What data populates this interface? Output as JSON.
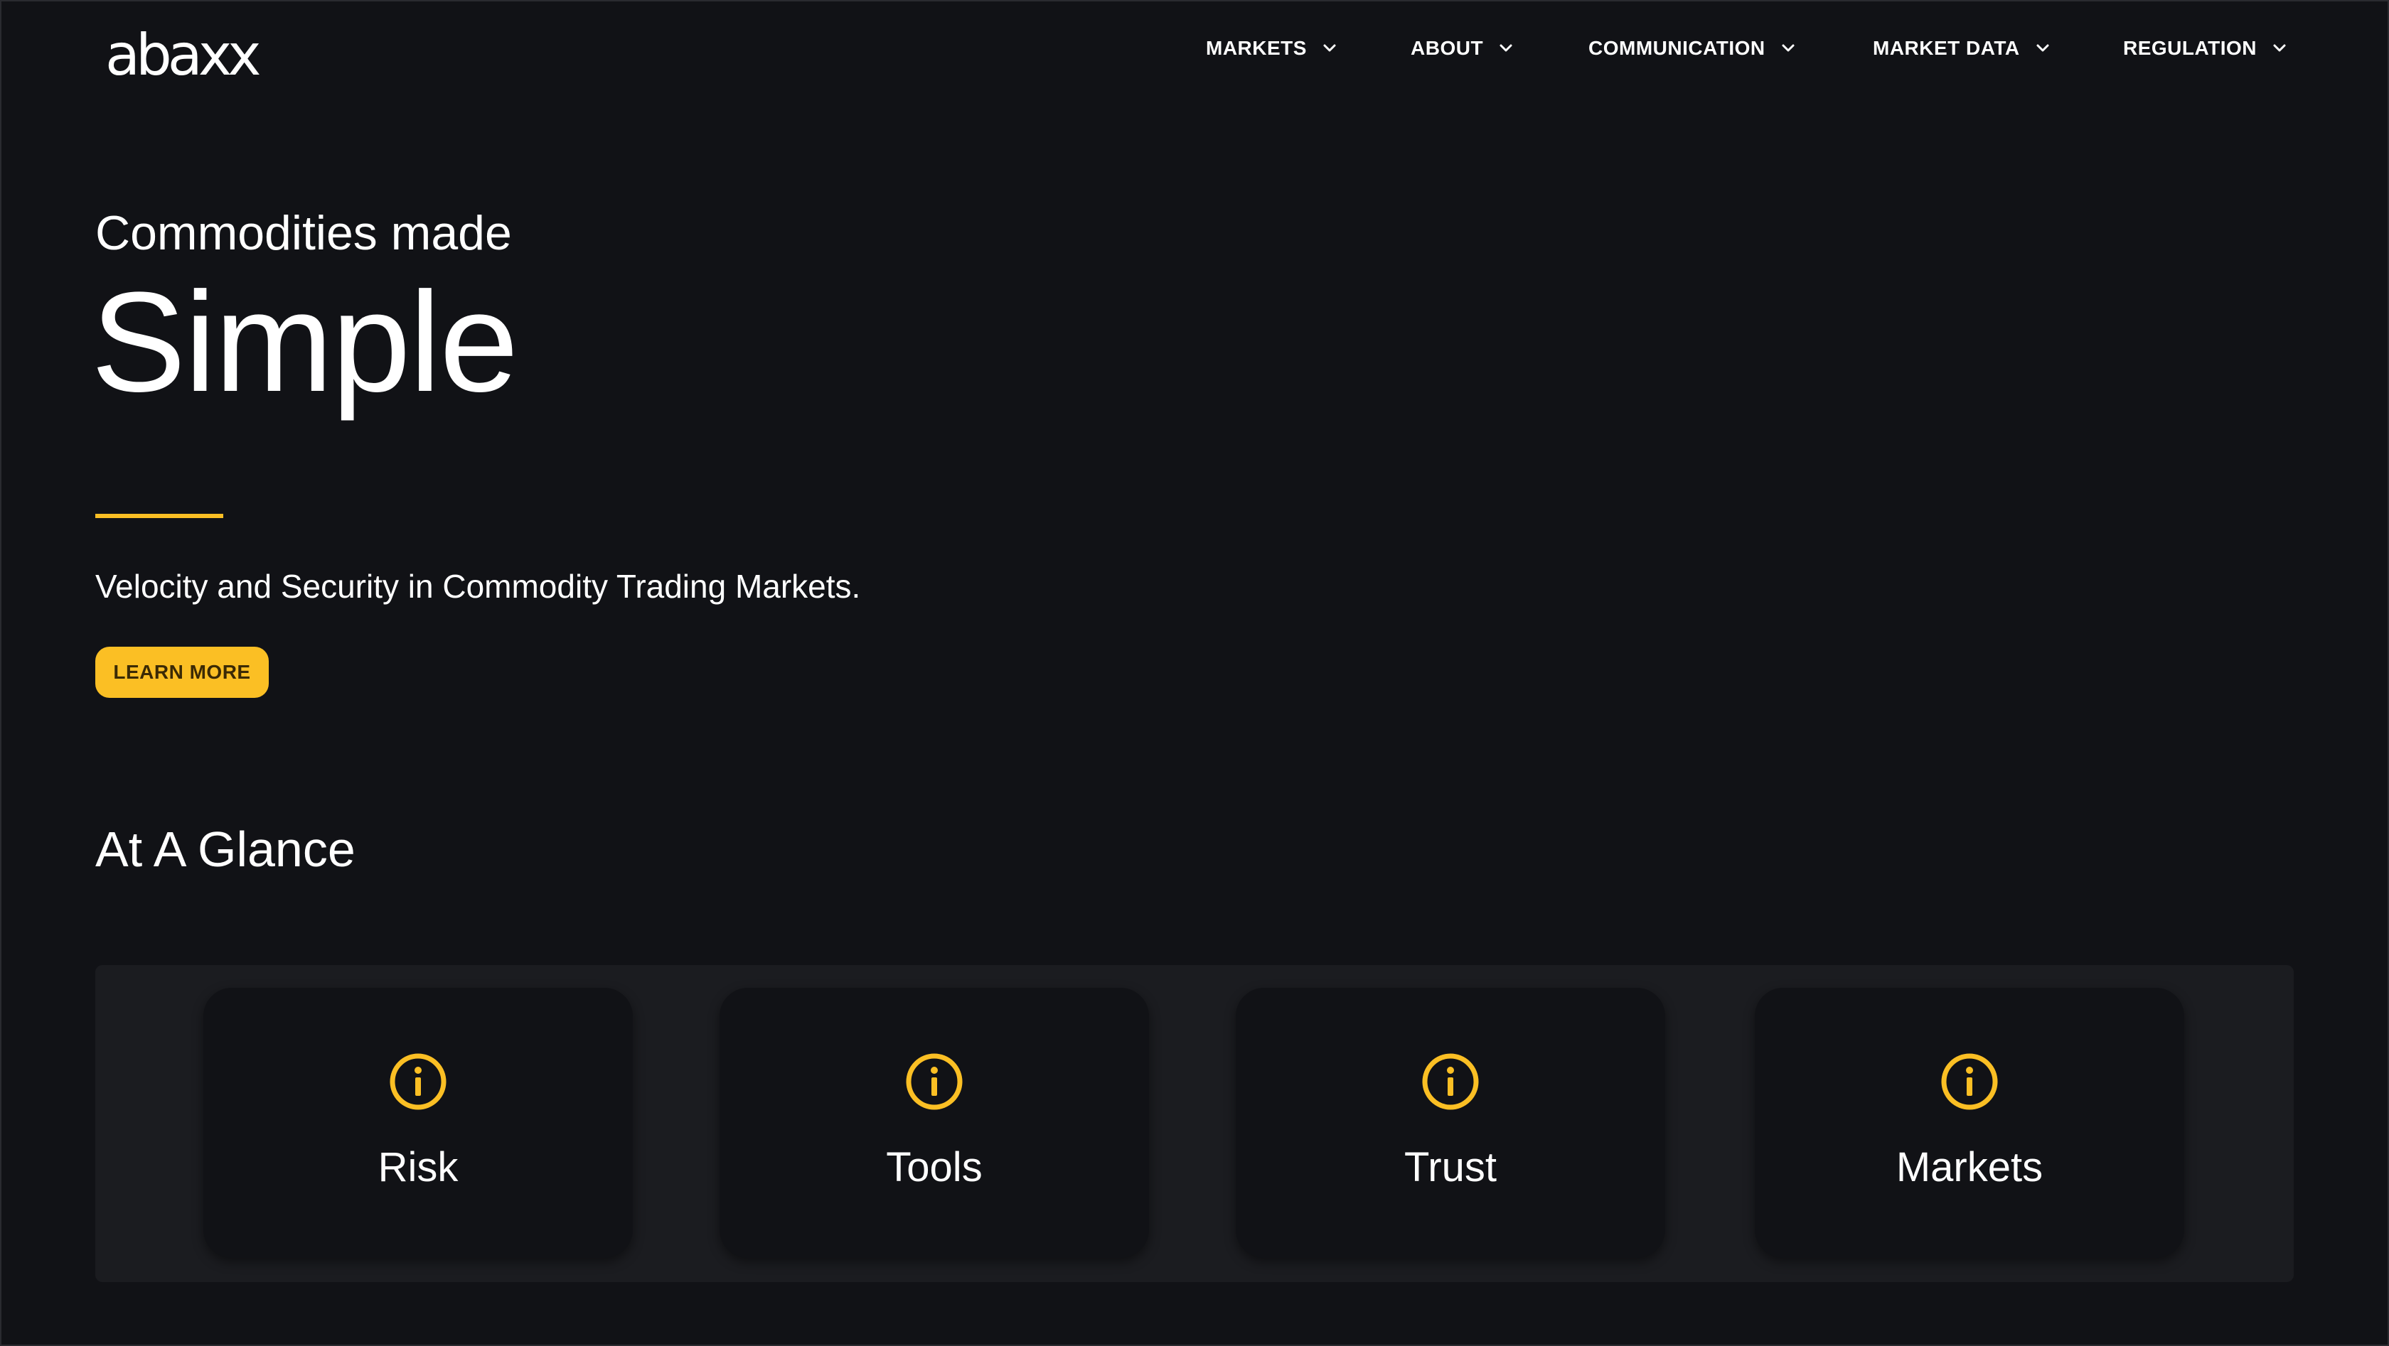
{
  "brand": {
    "logo_text": "abaxx",
    "accent_color": "#fbbf24",
    "background_color": "#111216"
  },
  "nav": {
    "items": [
      {
        "label": "MARKETS",
        "icon": "chevron-down-icon"
      },
      {
        "label": "ABOUT",
        "icon": "chevron-down-icon"
      },
      {
        "label": "COMMUNICATION",
        "icon": "chevron-down-icon"
      },
      {
        "label": "MARKET DATA",
        "icon": "chevron-down-icon"
      },
      {
        "label": "REGULATION",
        "icon": "chevron-down-icon"
      }
    ]
  },
  "hero": {
    "kicker": "Commodities made",
    "title": "Simple",
    "subtitle": "Velocity and Security in Commodity Trading Markets.",
    "cta_label": "LEARN MORE"
  },
  "glance": {
    "title": "At A Glance",
    "cards": [
      {
        "label": "Risk",
        "icon": "info-icon"
      },
      {
        "label": "Tools",
        "icon": "info-icon"
      },
      {
        "label": "Trust",
        "icon": "info-icon"
      },
      {
        "label": "Markets",
        "icon": "info-icon"
      }
    ]
  }
}
